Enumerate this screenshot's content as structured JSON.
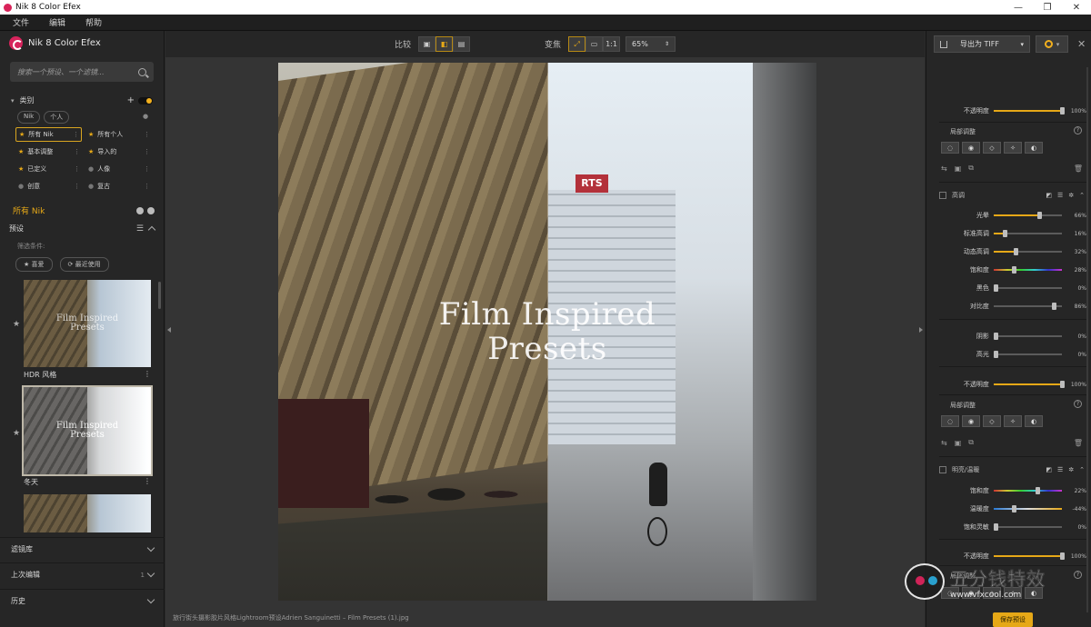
{
  "window": {
    "title": "Nik 8 Color Efex",
    "minimize": "—",
    "maximize": "❐",
    "close": "✕"
  },
  "menu": [
    "文件",
    "编辑",
    "帮助"
  ],
  "brand": "Nik 8 Color Efex",
  "search": {
    "placeholder": "搜索一个预设、一个滤镜..."
  },
  "categories": {
    "header": "类别",
    "chips": [
      "Nik",
      "个人"
    ],
    "items": [
      {
        "label": "所有 Nik",
        "marker": "star",
        "active": true
      },
      {
        "label": "所有个人",
        "marker": "star",
        "active": false
      },
      {
        "label": "基本调整",
        "marker": "star",
        "active": false
      },
      {
        "label": "导入的",
        "marker": "star",
        "active": false
      },
      {
        "label": "已定义",
        "marker": "star",
        "active": false
      },
      {
        "label": "人像",
        "marker": "dot",
        "active": false
      },
      {
        "label": "创意",
        "marker": "dot",
        "active": false
      },
      {
        "label": "复古",
        "marker": "dot",
        "active": false
      }
    ]
  },
  "all_nik_label": "所有 Nik",
  "presets": {
    "header": "预设",
    "filter_label": "筛选条件:",
    "filter_chips": [
      "★ 喜爱",
      "⟳ 最近使用"
    ],
    "thumbs": [
      {
        "name": "HDR 风格",
        "overlay_line1": "Film Inspired",
        "overlay_line2": "Presets"
      },
      {
        "name": "冬天",
        "overlay_line1": "Film Inspired",
        "overlay_line2": "Presets"
      }
    ]
  },
  "left_sections": [
    {
      "label": "滤镜库",
      "badge": ""
    },
    {
      "label": "上次编辑",
      "badge": "1"
    },
    {
      "label": "历史",
      "badge": ""
    }
  ],
  "toolbar": {
    "compare_label": "比较",
    "zoom_label": "变焦",
    "zoom_fit": "1:1",
    "zoom_value": "65%"
  },
  "canvas": {
    "title_line1": "Film Inspired",
    "title_line2": "Presets",
    "sign": "RTS"
  },
  "status": "旅行街头摄影胶片风格Lightroom预设Adrien Sanguinetti – Film Presets (1).jpg",
  "right": {
    "export_label": "导出为 TIFF",
    "opacity_top": {
      "label": "不透明度",
      "value": 100
    },
    "local_adjust_label": "局部调整",
    "section_detail": {
      "title": "高调",
      "sliders": [
        {
          "label": "光晕",
          "value": 66
        },
        {
          "label": "标准高调",
          "value": 16
        },
        {
          "label": "动态高调",
          "value": 32
        },
        {
          "label": "饱和度",
          "value": 28
        },
        {
          "label": "黑色",
          "value": 0
        },
        {
          "label": "对比度",
          "value": 86
        },
        {
          "label": "阴影",
          "value": 0
        },
        {
          "label": "高光",
          "value": 0
        }
      ],
      "opacity": {
        "label": "不透明度",
        "value": 100
      }
    },
    "local_adjust_label_2": "局部调整",
    "section_color": {
      "title": "明亮/温暖",
      "sliders": [
        {
          "label": "饱和度",
          "value": 22
        },
        {
          "label": "温暖度",
          "value": -44
        },
        {
          "label": "饱和灵敏",
          "value": 0
        }
      ],
      "opacity": {
        "label": "不透明度",
        "value": 100
      }
    },
    "local_adjust_label_3": "局部调整",
    "save_preset": "保存预设"
  },
  "watermark": {
    "main": "五分钱特效",
    "sub": "www.vfxcool.com"
  },
  "colors": {
    "accent": "#e6a817",
    "brand": "#d6245c",
    "panel": "#262626",
    "workspace": "#343434"
  }
}
